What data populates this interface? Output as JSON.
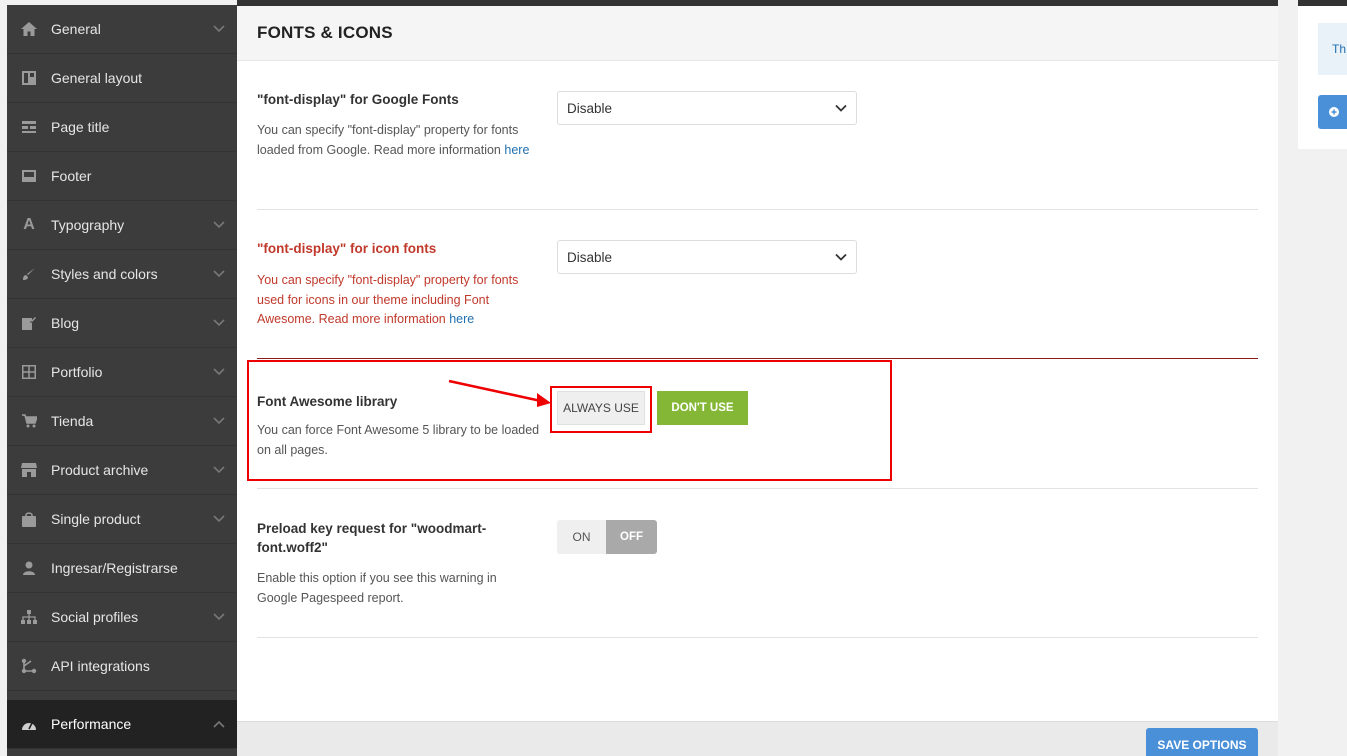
{
  "sidebar": {
    "items": [
      {
        "label": "General",
        "icon": "home-icon",
        "chevron": true
      },
      {
        "label": "General layout",
        "icon": "layout-icon",
        "chevron": false
      },
      {
        "label": "Page title",
        "icon": "page-title-icon",
        "chevron": false
      },
      {
        "label": "Footer",
        "icon": "footer-icon",
        "chevron": false
      },
      {
        "label": "Typography",
        "icon": "typography-icon",
        "chevron": true
      },
      {
        "label": "Styles and colors",
        "icon": "brush-icon",
        "chevron": true
      },
      {
        "label": "Blog",
        "icon": "edit-icon",
        "chevron": true
      },
      {
        "label": "Portfolio",
        "icon": "grid-icon",
        "chevron": true
      },
      {
        "label": "Tienda",
        "icon": "cart-icon",
        "chevron": true
      },
      {
        "label": "Product archive",
        "icon": "store-icon",
        "chevron": true
      },
      {
        "label": "Single product",
        "icon": "bag-icon",
        "chevron": true
      },
      {
        "label": "Ingresar/Registrarse",
        "icon": "user-icon",
        "chevron": false
      },
      {
        "label": "Social profiles",
        "icon": "network-icon",
        "chevron": true
      },
      {
        "label": "API integrations",
        "icon": "api-icon",
        "chevron": false
      }
    ],
    "active": {
      "label": "Performance",
      "icon": "gauge-icon"
    }
  },
  "main": {
    "title": "FONTS & ICONS",
    "google_fonts": {
      "title": "\"font-display\" for Google Fonts",
      "desc": "You can specify \"font-display\" property for fonts loaded from Google. Read more information",
      "link": "here",
      "value": "Disable"
    },
    "icon_fonts": {
      "title": "\"font-display\" for icon fonts",
      "desc": "You can specify \"font-display\" property for fonts used for icons in our theme including Font Awesome. Read more information",
      "link": "here",
      "value": "Disable"
    },
    "font_awesome": {
      "title": "Font Awesome library",
      "desc": "You can force Font Awesome 5 library to be loaded on all pages.",
      "always_label": "ALWAYS USE",
      "dont_label": "DON'T USE"
    },
    "preload": {
      "title": "Preload key request for \"woodmart-font.woff2\"",
      "desc": "Enable this option if you see this warning in Google Pagespeed report.",
      "on_label": "ON",
      "off_label": "OFF"
    }
  },
  "footer": {
    "save_label": "SAVE OPTIONS"
  },
  "right_panel": {
    "info_text": "Th"
  },
  "colors": {
    "accent_green": "#83b735",
    "save_blue": "#4a90d9",
    "highlight_red": "#e00000"
  }
}
